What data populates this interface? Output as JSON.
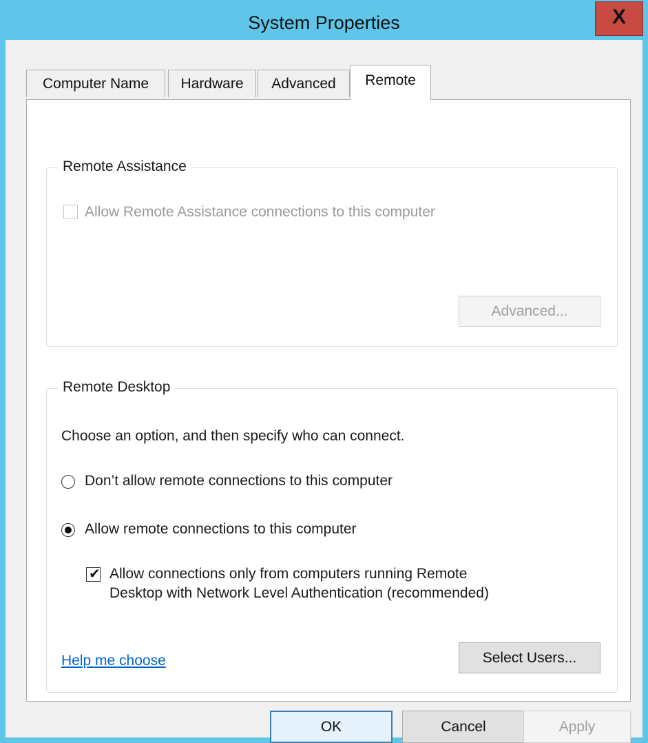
{
  "window": {
    "title": "System Properties",
    "close_glyph": "X"
  },
  "tabs": [
    {
      "label": "Computer Name"
    },
    {
      "label": "Hardware"
    },
    {
      "label": "Advanced"
    },
    {
      "label": "Remote"
    }
  ],
  "active_tab": "Remote",
  "remote_assistance": {
    "group_label": "Remote Assistance",
    "checkbox_label": "Allow Remote Assistance connections to this computer",
    "checkbox_checked": false,
    "checkbox_disabled": true,
    "advanced_button": "Advanced..."
  },
  "remote_desktop": {
    "group_label": "Remote Desktop",
    "instruction": "Choose an option, and then specify who can connect.",
    "option_dont_allow": "Don’t allow remote connections to this computer",
    "option_allow": "Allow remote connections to this computer",
    "selected_option": "allow",
    "nla_label_line1": "Allow connections only from computers running Remote",
    "nla_label_line2": "Desktop with Network Level Authentication (recommended)",
    "nla_checked": true,
    "help_link": "Help me choose",
    "select_users_button": "Select Users..."
  },
  "footer": {
    "ok": "OK",
    "cancel": "Cancel",
    "apply": "Apply"
  },
  "colors": {
    "titlebar": "#5fc6ea",
    "close": "#c74a43",
    "link": "#0066cc"
  }
}
